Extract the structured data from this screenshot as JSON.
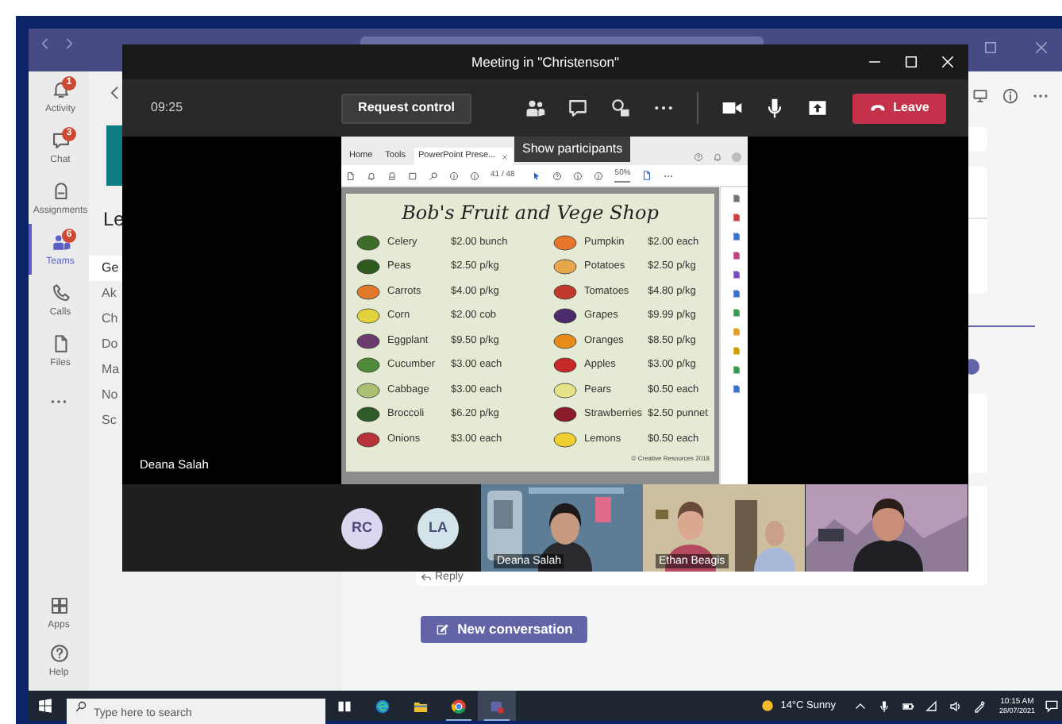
{
  "rail": [
    {
      "label": "Activity",
      "badge": "1",
      "selected": false
    },
    {
      "label": "Chat",
      "badge": "3",
      "selected": false
    },
    {
      "label": "Assignments",
      "selected": false
    },
    {
      "label": "Teams",
      "badge": "6",
      "selected": true
    },
    {
      "label": "Calls",
      "selected": false
    },
    {
      "label": "Files",
      "selected": false
    }
  ],
  "rail_bottom": [
    {
      "label": "Apps"
    },
    {
      "label": "Help"
    }
  ],
  "team_panel": {
    "team_name": "Le",
    "channels": [
      {
        "label": "Ge",
        "selected": true
      },
      {
        "label": "Ak",
        "selected": false
      },
      {
        "label": "Ch",
        "selected": false
      },
      {
        "label": "Do",
        "selected": false
      },
      {
        "label": "Ma",
        "selected": false
      },
      {
        "label": "No",
        "selected": false
      },
      {
        "label": "Sc",
        "selected": false
      }
    ]
  },
  "channel": {
    "reply": "Reply",
    "new_conversation": "New conversation"
  },
  "meeting": {
    "title": "Meeting in \"Christenson\"",
    "time": "09:25",
    "request_control": "Request control",
    "leave": "Leave",
    "tooltip": "Show participants",
    "presenter": "Deana Salah",
    "shared_screen": {
      "tabs": [
        {
          "label": "Home",
          "selected": false
        },
        {
          "label": "Tools",
          "selected": false
        },
        {
          "label": "PowerPoint Prese...",
          "selected": true
        }
      ],
      "page": "41 / 48",
      "zoom": "50%",
      "slide": {
        "title": "Bob's Fruit and Vege Shop",
        "footer": "© Creative Resources 2018",
        "columns": [
          [
            {
              "name": "Celery",
              "price": "$2.00 bunch",
              "color": "#3d6b2a"
            },
            {
              "name": "Peas",
              "price": "$2.50 p/kg",
              "color": "#2f5a1e"
            },
            {
              "name": "Carrots",
              "price": "$4.00 p/kg",
              "color": "#e07a2a"
            },
            {
              "name": "Corn",
              "price": "$2.00 cob",
              "color": "#e3d43e"
            },
            {
              "name": "Eggplant",
              "price": "$9.50 p/kg",
              "color": "#6b3b6e"
            },
            {
              "name": "Cucumber",
              "price": "$3.00 each",
              "color": "#4f8a3a"
            },
            {
              "name": "Cabbage",
              "price": "$3.00 each",
              "color": "#a8c070"
            },
            {
              "name": "Broccoli",
              "price": "$6.20 p/kg",
              "color": "#2f5a2a"
            },
            {
              "name": "Onions",
              "price": "$3.00 each",
              "color": "#b8323a"
            }
          ],
          [
            {
              "name": "Pumpkin",
              "price": "$2.00 each",
              "color": "#e8762a"
            },
            {
              "name": "Potatoes",
              "price": "$2.50 p/kg",
              "color": "#e6a84a"
            },
            {
              "name": "Tomatoes",
              "price": "$4.80 p/kg",
              "color": "#c0392b"
            },
            {
              "name": "Grapes",
              "price": "$9.99 p/kg",
              "color": "#4a2a6a"
            },
            {
              "name": "Oranges",
              "price": "$8.50 p/kg",
              "color": "#e88a1a"
            },
            {
              "name": "Apples",
              "price": "$3.00 p/kg",
              "color": "#c62828"
            },
            {
              "name": "Pears",
              "price": "$0.50 each",
              "color": "#e6e48a"
            },
            {
              "name": "Strawberries",
              "price": "$2.50 punnet",
              "color": "#8b1a2a"
            },
            {
              "name": "Lemons",
              "price": "$0.50 each",
              "color": "#f0d030"
            }
          ]
        ]
      }
    },
    "participants": [
      {
        "initials": "RC",
        "color": "#ddd6f0"
      },
      {
        "initials": "LA",
        "color": "#d3e3ea"
      }
    ],
    "video_tiles": [
      {
        "kind": "picture",
        "name": "Deana Salah"
      },
      {
        "kind": "picture",
        "name": "Ethan Beagis"
      },
      {
        "kind": "picture"
      }
    ]
  },
  "taskbar": {
    "search_placeholder": "Type here to search",
    "apps": [
      {
        "running": false,
        "selected": false
      },
      {
        "running": false,
        "selected": false
      },
      {
        "running": false,
        "selected": false
      },
      {
        "running": true,
        "selected": false
      },
      {
        "running": true,
        "selected": true
      }
    ],
    "weather": "14°C Sunny",
    "time": "10:15 AM",
    "date": "28/07/2021"
  }
}
